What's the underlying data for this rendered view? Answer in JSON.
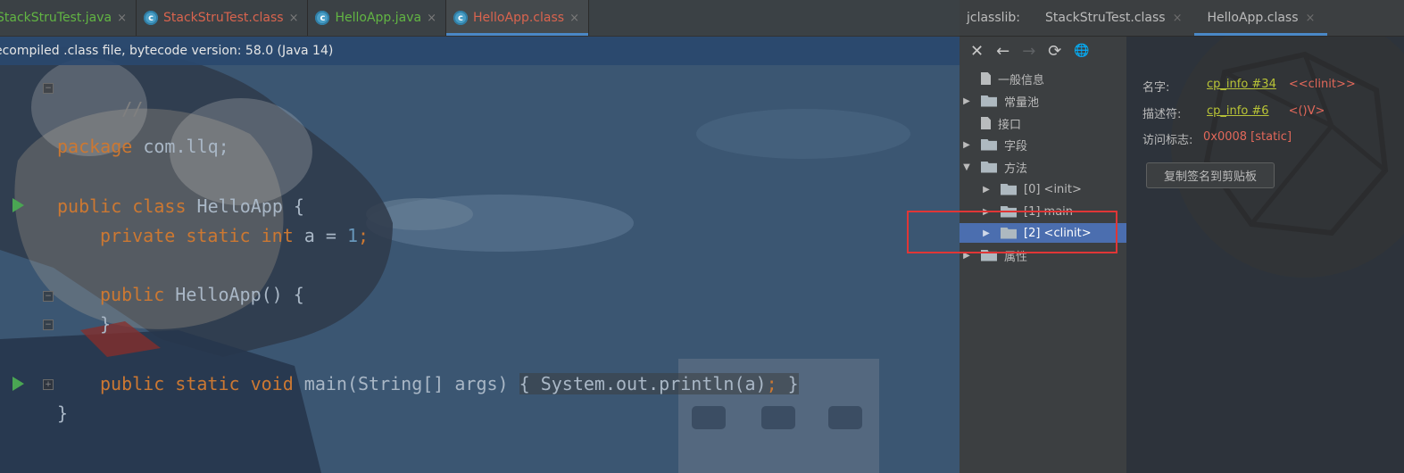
{
  "editor": {
    "tabs": [
      {
        "label": "StackStruTest.java",
        "kind": "java",
        "icon": "c-icon",
        "active": false
      },
      {
        "label": "StackStruTest.class",
        "kind": "class",
        "icon": "class-c-icon",
        "active": false
      },
      {
        "label": "HelloApp.java",
        "kind": "java",
        "icon": "class-c-icon",
        "active": false
      },
      {
        "label": "HelloApp.class",
        "kind": "class",
        "icon": "class-c-icon",
        "active": true
      }
    ],
    "close_glyph": "×",
    "info_bar": "ecompiled .class file, bytecode version: 58.0 (Java 14)",
    "code": {
      "l0": "//",
      "l2_kw": "package",
      "l2_rest": " com.llq;",
      "l4_kw1": "public class",
      "l4_rest": " HelloApp {",
      "l5_kw": "private static int",
      "l5_var": " a = ",
      "l5_num": "1",
      "l5_end": ";",
      "l7_kw": "public",
      "l7_rest": " HelloApp() {",
      "l8": "}",
      "l10_kw": "public static void",
      "l10_a": " main(String[] args) ",
      "l10_b": "{ System.out.println(a)",
      "l10_c": ";",
      "l10_d": " }",
      "l11": "}"
    }
  },
  "jclasslib": {
    "title": "jclasslib:",
    "tabs": [
      {
        "label": "StackStruTest.class",
        "active": false
      },
      {
        "label": "HelloApp.class",
        "active": true
      }
    ],
    "toolbar": {
      "close": "✕",
      "back": "←",
      "forward": "→",
      "refresh": "⟳",
      "web": "🌐"
    },
    "tree": [
      {
        "label": "一般信息",
        "icon": "file-icon",
        "expand": ""
      },
      {
        "label": "常量池",
        "icon": "folder-icon",
        "expand": "▶"
      },
      {
        "label": "接口",
        "icon": "file-icon",
        "expand": ""
      },
      {
        "label": "字段",
        "icon": "folder-icon",
        "expand": "▶"
      },
      {
        "label": "方法",
        "icon": "folder-icon",
        "expand": "▼"
      },
      {
        "label": "[0] <init>",
        "icon": "folder-icon",
        "expand": "▶"
      },
      {
        "label": "[1] main",
        "icon": "folder-icon",
        "expand": "▶"
      },
      {
        "label": "[2] <clinit>",
        "icon": "folder-icon",
        "expand": "▶",
        "selected": true
      },
      {
        "label": "属性",
        "icon": "folder-icon",
        "expand": "▶"
      }
    ],
    "detail": {
      "name_label": "名字:",
      "name_link": "cp_info #34",
      "name_value": "<<clinit>>",
      "descriptor_label": "描述符:",
      "descriptor_link": "cp_info #6",
      "descriptor_value": "<()V>",
      "access_label": "访问标志:",
      "access_value": "0x0008 [static]",
      "copy_button": "复制签名到剪贴板"
    }
  },
  "colors": {
    "keyword": "#cc7832",
    "number": "#6897bb",
    "selection": "#4b6eaf",
    "highlight": "#e03636",
    "link": "#b9c437"
  }
}
